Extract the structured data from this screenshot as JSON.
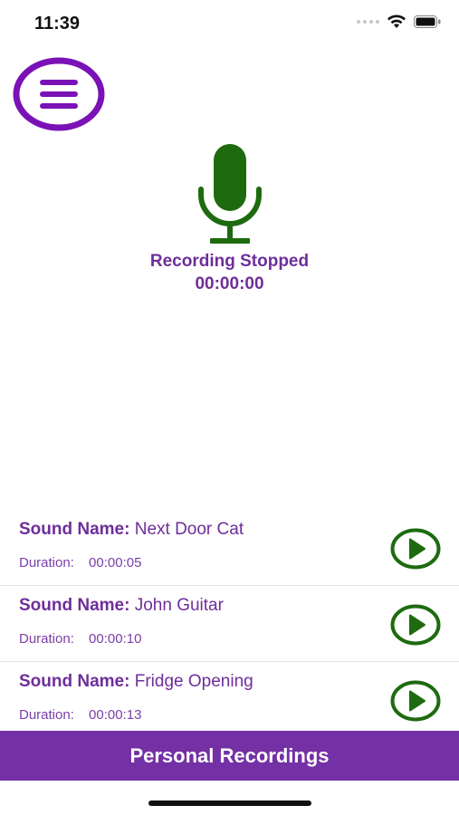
{
  "status_bar": {
    "time": "11:39"
  },
  "colors": {
    "brand_purple": "#7430a5",
    "text_purple": "#6e2e9a",
    "mic_green": "#1e6b0f"
  },
  "icons": {
    "menu": "hamburger-menu-icon",
    "microphone": "microphone-icon",
    "play": "play-icon"
  },
  "recorder": {
    "status": "Recording Stopped",
    "time": "00:00:00"
  },
  "recordings": [
    {
      "name_label": "Sound Name:",
      "name": "Next Door Cat",
      "duration_label": "Duration:",
      "duration": "00:00:05"
    },
    {
      "name_label": "Sound Name:",
      "name": "John Guitar",
      "duration_label": "Duration:",
      "duration": "00:00:10"
    },
    {
      "name_label": "Sound Name:",
      "name": "Fridge Opening",
      "duration_label": "Duration:",
      "duration": "00:00:13"
    }
  ],
  "bottom_bar": {
    "label": "Personal Recordings"
  }
}
